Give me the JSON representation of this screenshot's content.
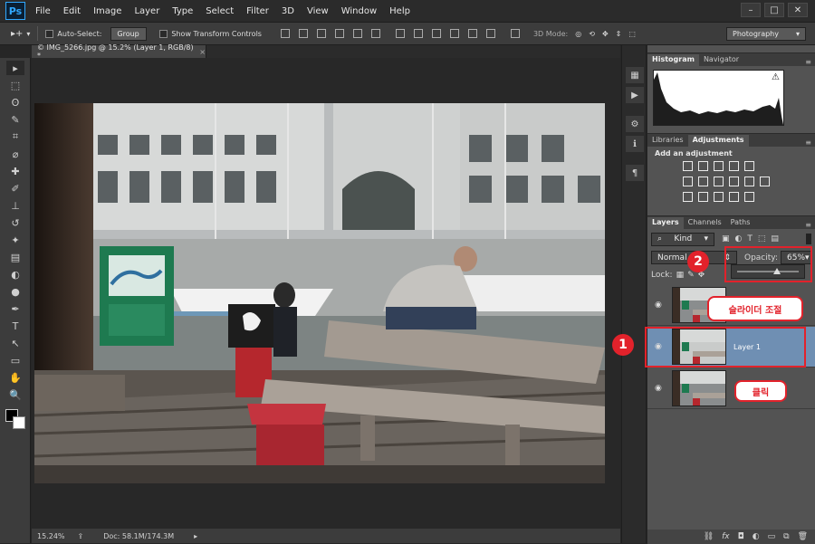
{
  "app": {
    "logo": "Ps"
  },
  "menu": [
    "File",
    "Edit",
    "Image",
    "Layer",
    "Type",
    "Select",
    "Filter",
    "3D",
    "View",
    "Window",
    "Help"
  ],
  "window_controls": [
    "–",
    "□",
    "✕"
  ],
  "options_bar": {
    "move_tool": "▸+",
    "auto_select_label": "Auto-Select:",
    "auto_select_value": "Group",
    "show_transform_label": "Show Transform Controls",
    "mode_3d_label": "3D Mode:",
    "workspace": "Photography"
  },
  "document": {
    "tab_title": "© IMG_5266.jpg @ 15.2% (Layer 1, RGB/8) *",
    "close": "×",
    "zoom": "15.24%",
    "doc_info": "Doc: 58.1M/174.3M"
  },
  "tools": [
    "▸",
    "⬚",
    "ʘ",
    "✎",
    "⌗",
    "⌀",
    "✚",
    "✐",
    "⊥",
    "↺",
    "✦",
    "▤",
    "◐",
    "●",
    "✒",
    "T",
    "↖",
    "▭",
    "✋",
    "🔍"
  ],
  "panels": {
    "histogram_tabs": [
      "Histogram",
      "Navigator"
    ],
    "adjust_tabs": [
      "Libraries",
      "Adjustments"
    ],
    "adjust_title": "Add an adjustment",
    "layers_tabs": [
      "Layers",
      "Channels",
      "Paths"
    ],
    "kind_label": "Kind",
    "blend_mode": "Normal",
    "opacity_label": "Opacity:",
    "opacity_value": "65%",
    "lock_label": "Lock:",
    "layers": [
      {
        "name": ""
      },
      {
        "name": "Layer 1"
      },
      {
        "name": ""
      }
    ]
  },
  "callouts": {
    "badge1": "1",
    "badge2": "2",
    "bubble_slider": "슬라이더 조절",
    "bubble_click": "클릭"
  }
}
